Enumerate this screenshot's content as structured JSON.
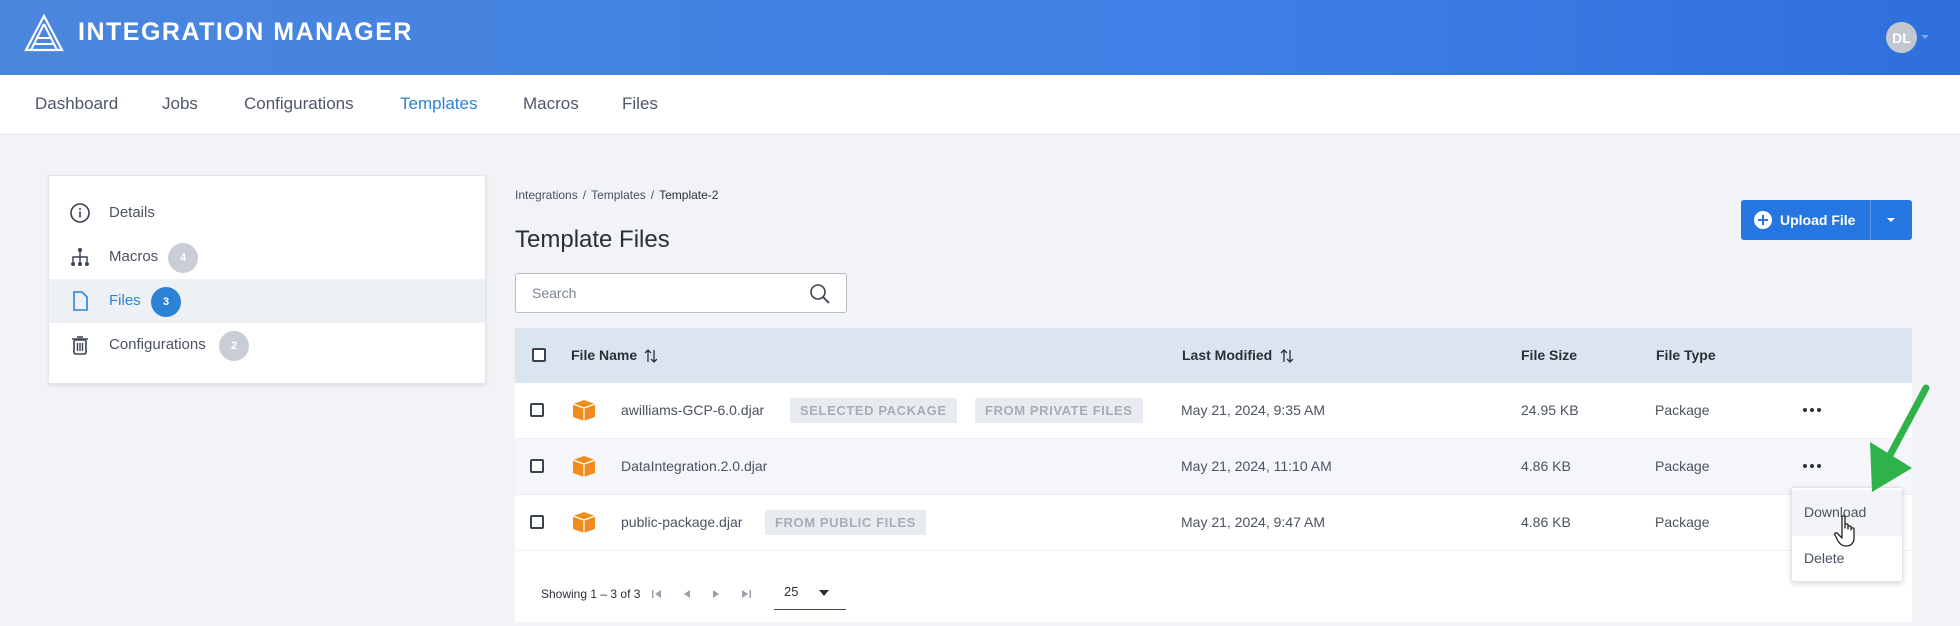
{
  "header": {
    "title": "INTEGRATION MANAGER",
    "avatar_initials": "DL"
  },
  "nav": {
    "tabs": [
      "Dashboard",
      "Jobs",
      "Configurations",
      "Templates",
      "Macros",
      "Files"
    ],
    "active": "Templates"
  },
  "sidebar": {
    "items": [
      {
        "label": "Details",
        "badge": null
      },
      {
        "label": "Macros",
        "badge": "4"
      },
      {
        "label": "Files",
        "badge": "3"
      },
      {
        "label": "Configurations",
        "badge": "2"
      }
    ],
    "active": "Files"
  },
  "breadcrumb": {
    "root": "Integrations",
    "section": "Templates",
    "current": "Template-2",
    "separator": "/"
  },
  "page": {
    "title": "Template Files"
  },
  "upload": {
    "label": "Upload File"
  },
  "search": {
    "placeholder": "Search"
  },
  "table": {
    "columns": {
      "name": "File Name",
      "modified": "Last Modified",
      "size": "File Size",
      "type": "File Type"
    },
    "rows": [
      {
        "name": "awilliams-GCP-6.0.djar",
        "tags": [
          "SELECTED PACKAGE",
          "FROM PRIVATE FILES"
        ],
        "modified": "May 21, 2024, 9:35 AM",
        "size": "24.95 KB",
        "type": "Package"
      },
      {
        "name": "DataIntegration.2.0.djar",
        "tags": [],
        "modified": "May 21, 2024, 11:10 AM",
        "size": "4.86 KB",
        "type": "Package"
      },
      {
        "name": "public-package.djar",
        "tags": [
          "FROM PUBLIC FILES"
        ],
        "modified": "May 21, 2024, 9:47 AM",
        "size": "4.86 KB",
        "type": "Package"
      }
    ]
  },
  "pager": {
    "summary": "Showing 1 – 3 of 3",
    "per_page": "25"
  },
  "row_menu": {
    "items": [
      "Download",
      "Delete"
    ],
    "hovered": "Download"
  },
  "colors": {
    "header_start": "#4a86dc",
    "header_end": "#2f6fdc",
    "accent": "#2c83d6",
    "button": "#2576e0",
    "package_icon": "#f08c1e",
    "annotation_arrow": "#2fb24a"
  },
  "icons": {
    "logo": "mountain-logo-icon",
    "details": "info-icon",
    "macros": "hierarchy-icon",
    "files": "file-icon",
    "configurations": "trash-icon",
    "search": "search-icon",
    "package": "package-icon",
    "sort": "sort-icon",
    "more": "more-icon"
  }
}
